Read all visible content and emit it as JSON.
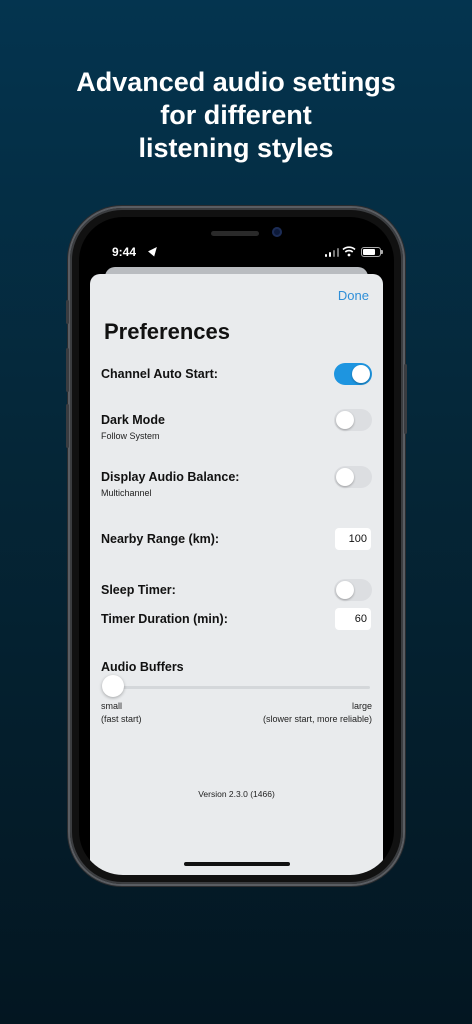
{
  "headline": {
    "line1": "Advanced audio settings",
    "line2": "for different",
    "line3": "listening styles"
  },
  "status_bar": {
    "time": "9:44",
    "icons": [
      "location-arrow-icon",
      "signal-bars-icon",
      "wifi-icon",
      "battery-icon"
    ]
  },
  "nav": {
    "done_label": "Done"
  },
  "preferences": {
    "title": "Preferences",
    "channel_auto_start": {
      "label": "Channel Auto Start:",
      "on": true
    },
    "dark_mode": {
      "label": "Dark Mode",
      "sublabel": "Follow System",
      "on": false
    },
    "display_audio_balance": {
      "label": "Display Audio Balance:",
      "sublabel": "Multichannel",
      "on": false
    },
    "nearby_range": {
      "label": "Nearby Range (km):",
      "value": "100"
    },
    "sleep_timer": {
      "label": "Sleep Timer:",
      "on": false
    },
    "timer_duration": {
      "label": "Timer Duration (min):",
      "value": "60"
    },
    "audio_buffers": {
      "label": "Audio Buffers",
      "value_fraction": 0.0,
      "min_label": "small",
      "min_hint": "(fast start)",
      "max_label": "large",
      "max_hint": "(slower start, more reliable)"
    },
    "version": "Version 2.3.0 (1466)"
  },
  "colors": {
    "accent": "#1e95e0",
    "link": "#2f8fd8",
    "sheet_bg": "#e9ebed",
    "page_bg": "#04344f"
  }
}
